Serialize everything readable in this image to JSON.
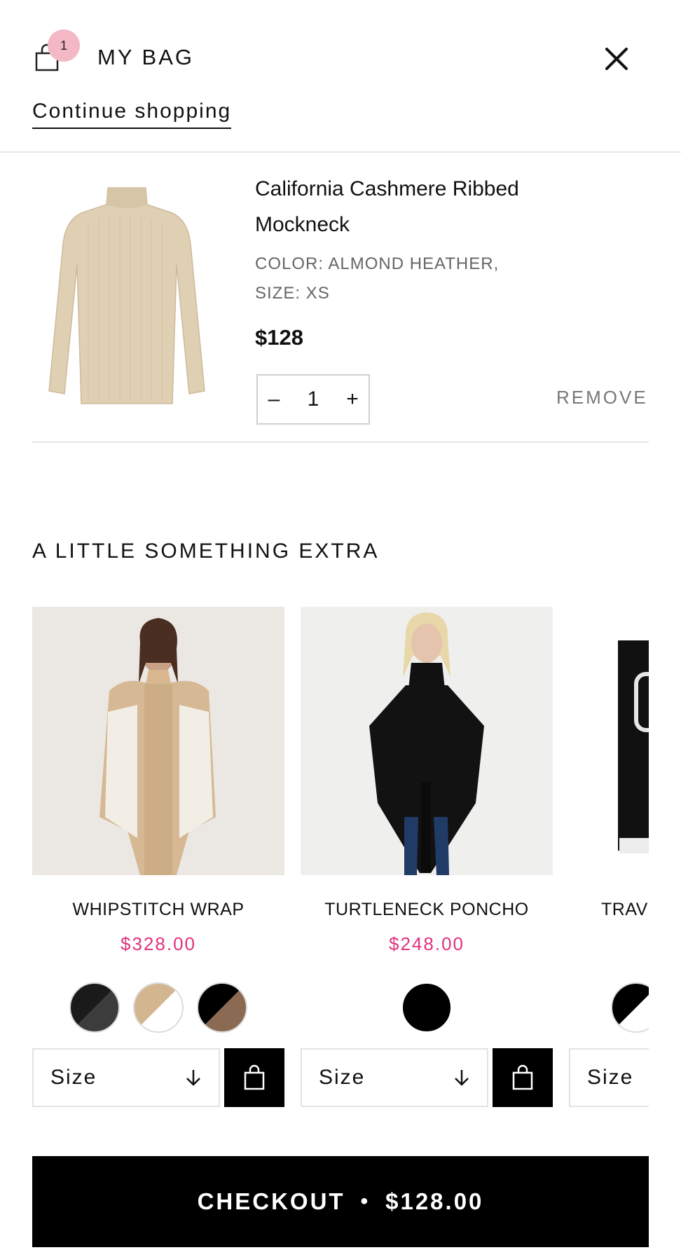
{
  "header": {
    "badge_count": "1",
    "title": "MY BAG",
    "continue_label": "Continue shopping"
  },
  "cart_item": {
    "name": "California Cashmere Ribbed Mockneck",
    "color_line": "COLOR: ALMOND HEATHER,",
    "size_line": "SIZE: XS",
    "price": "$128",
    "quantity": "1",
    "minus_label": "–",
    "plus_label": "+",
    "remove_label": "REMOVE"
  },
  "extras": {
    "title": "A LITTLE SOMETHING EXTRA",
    "products": [
      {
        "name": "WHIPSTITCH WRAP",
        "price": "$328.00",
        "size_label": "Size"
      },
      {
        "name": "TURTLENECK PONCHO",
        "price": "$248.00",
        "size_label": "Size"
      },
      {
        "name": "TRAV",
        "price": "",
        "size_label": "Size"
      }
    ]
  },
  "checkout": {
    "label": "CHECKOUT",
    "separator": "•",
    "total": "$128.00"
  },
  "colors": {
    "badge": "#f4b7c6",
    "price_accent": "#e0337f",
    "checkout_bg": "#000000"
  }
}
